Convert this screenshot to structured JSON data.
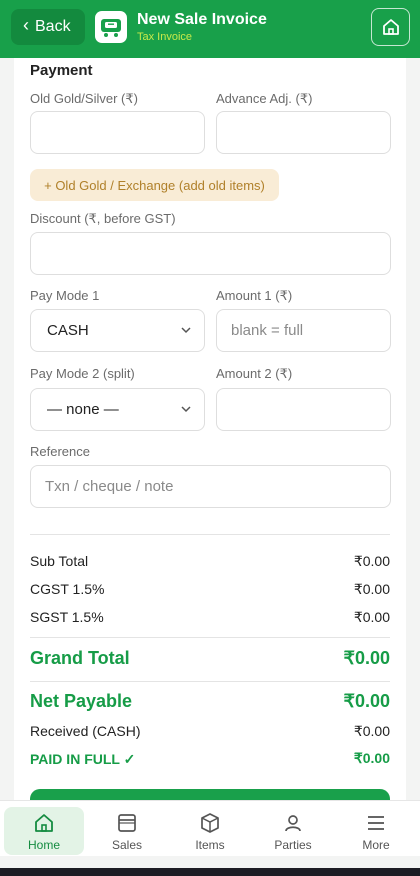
{
  "header": {
    "back_label": "Back",
    "title": "New Sale Invoice",
    "subtitle": "Tax Invoice",
    "accent": "#18a04a"
  },
  "payment": {
    "section_title": "Payment",
    "old_gold_label": "Old Gold/Silver (₹)",
    "advance_label": "Advance Adj. (₹)",
    "old_gold_value": "",
    "advance_value": "",
    "old_gold_button": "+ Old Gold / Exchange (add old items)",
    "discount_label": "Discount (₹, before GST)",
    "discount_value": "",
    "pay_mode_1_label": "Pay Mode 1",
    "pay_mode_1_value": "CASH",
    "amount_1_label": "Amount 1 (₹)",
    "amount_1_placeholder": "blank = full",
    "pay_mode_2_label": "Pay Mode 2 (split)",
    "pay_mode_2_value": "— none —",
    "amount_2_label": "Amount 2 (₹)",
    "amount_2_value": "",
    "reference_label": "Reference",
    "reference_placeholder": "Txn / cheque / note"
  },
  "totals": {
    "sub_total_label": "Sub Total",
    "sub_total_value": "₹0.00",
    "cgst_label": "CGST 1.5%",
    "cgst_value": "₹0.00",
    "sgst_label": "SGST 1.5%",
    "sgst_value": "₹0.00",
    "grand_total_label": "Grand Total",
    "grand_total_value": "₹0.00",
    "net_payable_label": "Net Payable",
    "net_payable_value": "₹0.00",
    "received_label": "Received (CASH)",
    "received_value": "₹0.00",
    "status_label": "PAID IN FULL ✓",
    "status_value": "₹0.00"
  },
  "bottom_nav": {
    "items": [
      {
        "label": "Home",
        "icon": "home-icon",
        "active": true
      },
      {
        "label": "Sales",
        "icon": "sales-icon",
        "active": false
      },
      {
        "label": "Items",
        "icon": "box-icon",
        "active": false
      },
      {
        "label": "Parties",
        "icon": "person-icon",
        "active": false
      },
      {
        "label": "More",
        "icon": "menu-icon",
        "active": false
      }
    ]
  }
}
